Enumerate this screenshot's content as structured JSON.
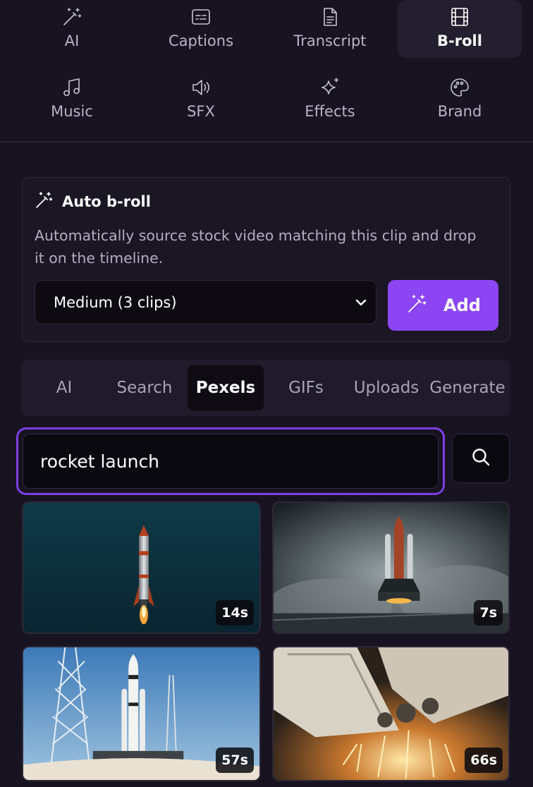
{
  "tools": [
    {
      "label": "AI",
      "icon": "magic-wand-icon",
      "active": false
    },
    {
      "label": "Captions",
      "icon": "captions-icon",
      "active": false
    },
    {
      "label": "Transcript",
      "icon": "document-icon",
      "active": false
    },
    {
      "label": "B-roll",
      "icon": "film-icon",
      "active": true
    },
    {
      "label": "Music",
      "icon": "music-note-icon",
      "active": false
    },
    {
      "label": "SFX",
      "icon": "speaker-icon",
      "active": false
    },
    {
      "label": "Effects",
      "icon": "sparkles-icon",
      "active": false
    },
    {
      "label": "Brand",
      "icon": "palette-icon",
      "active": false
    }
  ],
  "auto_broll": {
    "title": "Auto b-roll",
    "description": "Automatically source stock video matching this clip and drop it on the timeline.",
    "amount_selected": "Medium (3 clips)",
    "add_label": "Add"
  },
  "source_tabs": [
    {
      "label": "AI",
      "active": false
    },
    {
      "label": "Search",
      "active": false
    },
    {
      "label": "Pexels",
      "active": true
    },
    {
      "label": "GIFs",
      "active": false
    },
    {
      "label": "Uploads",
      "active": false
    },
    {
      "label": "Generate",
      "active": false
    }
  ],
  "search": {
    "query": "rocket launch"
  },
  "results": [
    {
      "duration": "14s"
    },
    {
      "duration": "7s"
    },
    {
      "duration": "57s"
    },
    {
      "duration": "66s"
    }
  ],
  "colors": {
    "accent": "#8b45f3",
    "background": "#181320",
    "focus_ring": "#7b3fe4"
  }
}
